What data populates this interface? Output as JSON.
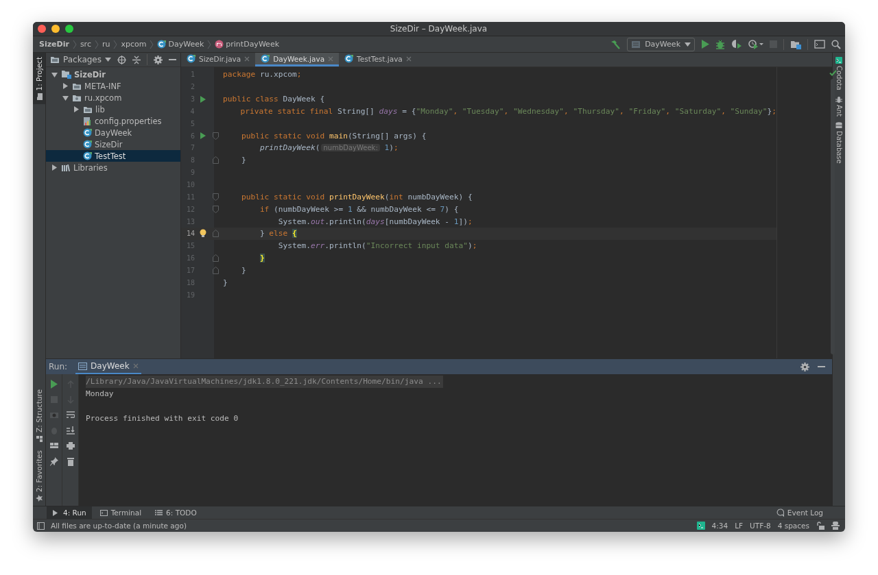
{
  "window": {
    "title": "SizeDir – DayWeek.java"
  },
  "breadcrumbs": [
    {
      "label": "SizeDir",
      "kind": "root"
    },
    {
      "label": "src",
      "kind": "folder"
    },
    {
      "label": "ru",
      "kind": "folder"
    },
    {
      "label": "xpcom",
      "kind": "folder"
    },
    {
      "label": "DayWeek",
      "kind": "class"
    },
    {
      "label": "printDayWeek",
      "kind": "method"
    }
  ],
  "toolbar": {
    "run_config": "DayWeek",
    "stop_disabled": true
  },
  "left_tool_tabs": [
    {
      "label": "1: Project",
      "selected": true,
      "kind": "project"
    },
    {
      "label": "Z: Structure",
      "selected": false,
      "kind": "structure"
    },
    {
      "label": "2: Favorites",
      "selected": false,
      "kind": "favorites"
    }
  ],
  "right_tool_tabs": [
    {
      "label": "Codota",
      "kind": "codota"
    },
    {
      "label": "Ant",
      "kind": "ant"
    },
    {
      "label": "Database",
      "kind": "database"
    }
  ],
  "project": {
    "view": "Packages",
    "tree": [
      {
        "label": "SizeDir",
        "kind": "module",
        "expanded": true,
        "selected": false,
        "children": [
          {
            "label": "META-INF",
            "kind": "folder",
            "expanded": false,
            "selected": false
          },
          {
            "label": "ru.xpcom",
            "kind": "package",
            "expanded": true,
            "selected": false,
            "children": [
              {
                "label": "lib",
                "kind": "folder",
                "expanded": false,
                "selected": false
              },
              {
                "label": "config.properties",
                "kind": "properties",
                "selected": false
              },
              {
                "label": "DayWeek",
                "kind": "class",
                "selected": false
              },
              {
                "label": "SizeDir",
                "kind": "class",
                "selected": false
              },
              {
                "label": "TestTest",
                "kind": "class",
                "selected": true
              }
            ]
          }
        ]
      },
      {
        "label": "Libraries",
        "kind": "library",
        "expanded": false,
        "selected": false
      }
    ]
  },
  "editor_tabs": [
    {
      "label": "SizeDir.java",
      "selected": false
    },
    {
      "label": "DayWeek.java",
      "selected": true
    },
    {
      "label": "TestTest.java",
      "selected": false
    }
  ],
  "code": [
    {
      "number": "1",
      "current": false,
      "tokens": [
        {
          "kind": "kw",
          "text": "package"
        },
        {
          "kind": "plain",
          "text": " ru.xpcom"
        },
        {
          "kind": "kw",
          "text": ";"
        }
      ]
    },
    {
      "number": "2",
      "current": false
    },
    {
      "number": "3",
      "current": false,
      "run": true,
      "tokens": [
        {
          "kind": "kw",
          "text": "public class"
        },
        {
          "kind": "plain",
          "text": " DayWeek {"
        }
      ]
    },
    {
      "number": "4",
      "current": false,
      "tokens": [
        {
          "kind": "kw",
          "text": "    private static final"
        },
        {
          "kind": "plain",
          "text": " String[] "
        },
        {
          "kind": "field",
          "text": "days"
        },
        {
          "kind": "plain",
          "text": " = {"
        },
        {
          "kind": "str",
          "text": "\"Monday\""
        },
        {
          "kind": "kw",
          "text": ", "
        },
        {
          "kind": "str",
          "text": "\"Tuesday\""
        },
        {
          "kind": "kw",
          "text": ", "
        },
        {
          "kind": "str",
          "text": "\"Wednesday\""
        },
        {
          "kind": "kw",
          "text": ", "
        },
        {
          "kind": "str",
          "text": "\"Thursday\""
        },
        {
          "kind": "kw",
          "text": ", "
        },
        {
          "kind": "str",
          "text": "\"Friday\""
        },
        {
          "kind": "kw",
          "text": ", "
        },
        {
          "kind": "str",
          "text": "\"Saturday\""
        },
        {
          "kind": "kw",
          "text": ", "
        },
        {
          "kind": "str",
          "text": "\"Sunday\""
        },
        {
          "kind": "plain",
          "text": "}"
        },
        {
          "kind": "kw",
          "text": ";"
        }
      ]
    },
    {
      "number": "5",
      "current": false
    },
    {
      "number": "6",
      "current": false,
      "run": true,
      "fold_open": true,
      "tokens": [
        {
          "kind": "kw",
          "text": "    public static void "
        },
        {
          "kind": "decl",
          "text": "main"
        },
        {
          "kind": "plain",
          "text": "(String[] args) {"
        }
      ]
    },
    {
      "number": "7",
      "current": false,
      "tokens": [
        {
          "kind": "call",
          "text": "        printDayWeek"
        },
        {
          "kind": "plain",
          "text": "("
        },
        {
          "kind": "hint",
          "text": "numbDayWeek:"
        },
        {
          "kind": "num",
          "text": " 1"
        },
        {
          "kind": "plain",
          "text": ")"
        },
        {
          "kind": "kw",
          "text": ";"
        }
      ]
    },
    {
      "number": "8",
      "current": false,
      "fold_close": true,
      "tokens": [
        {
          "kind": "plain",
          "text": "    }"
        }
      ]
    },
    {
      "number": "9",
      "current": false
    },
    {
      "number": "10",
      "current": false
    },
    {
      "number": "11",
      "current": false,
      "fold_open": true,
      "tokens": [
        {
          "kind": "kw",
          "text": "    public static void "
        },
        {
          "kind": "decl",
          "text": "printDayWeek"
        },
        {
          "kind": "plain",
          "text": "("
        },
        {
          "kind": "kw",
          "text": "int"
        },
        {
          "kind": "plain",
          "text": " numbDayWeek) {"
        }
      ]
    },
    {
      "number": "12",
      "current": false,
      "fold_open": true,
      "tokens": [
        {
          "kind": "kw",
          "text": "        if"
        },
        {
          "kind": "plain",
          "text": " (numbDayWeek >= "
        },
        {
          "kind": "num",
          "text": "1"
        },
        {
          "kind": "plain",
          "text": " && numbDayWeek <= "
        },
        {
          "kind": "num",
          "text": "7"
        },
        {
          "kind": "plain",
          "text": ") {"
        }
      ]
    },
    {
      "number": "13",
      "current": false,
      "tokens": [
        {
          "kind": "plain",
          "text": "            System."
        },
        {
          "kind": "field",
          "text": "out"
        },
        {
          "kind": "plain",
          "text": ".println("
        },
        {
          "kind": "field",
          "text": "days"
        },
        {
          "kind": "plain",
          "text": "[numbDayWeek - "
        },
        {
          "kind": "num",
          "text": "1"
        },
        {
          "kind": "plain",
          "text": "])"
        },
        {
          "kind": "kw",
          "text": ";"
        }
      ]
    },
    {
      "number": "14",
      "current": true,
      "fold_close": true,
      "bulb": true,
      "tokens": [
        {
          "kind": "plain",
          "text": "        } "
        },
        {
          "kind": "kw",
          "text": "else "
        },
        {
          "kind": "brace",
          "text": "{"
        }
      ]
    },
    {
      "number": "15",
      "current": false,
      "tokens": [
        {
          "kind": "plain",
          "text": "            System."
        },
        {
          "kind": "field",
          "text": "err"
        },
        {
          "kind": "plain",
          "text": ".println("
        },
        {
          "kind": "str",
          "text": "\"Incorrect input data\""
        },
        {
          "kind": "plain",
          "text": ")"
        },
        {
          "kind": "kw",
          "text": ";"
        }
      ]
    },
    {
      "number": "16",
      "current": false,
      "fold_close": true,
      "tokens": [
        {
          "kind": "brace",
          "text": "        }"
        }
      ]
    },
    {
      "number": "17",
      "current": false,
      "fold_close": true,
      "tokens": [
        {
          "kind": "plain",
          "text": "    }"
        }
      ]
    },
    {
      "number": "18",
      "current": false,
      "tokens": [
        {
          "kind": "plain",
          "text": "}"
        }
      ]
    },
    {
      "number": "19",
      "current": false
    }
  ],
  "run_panel": {
    "label": "Run:",
    "tabs": [
      {
        "label": "DayWeek",
        "selected": true
      }
    ],
    "console": [
      {
        "kind": "command",
        "text": "/Library/Java/JavaVirtualMachines/jdk1.8.0_221.jdk/Contents/Home/bin/java ..."
      },
      {
        "kind": "output",
        "text": "Monday"
      },
      {
        "kind": "exit",
        "text": "Process finished with exit code 0"
      }
    ]
  },
  "bottom_tool_tabs": [
    {
      "label": "4: Run",
      "kind": "run",
      "selected": true
    },
    {
      "label": "Terminal",
      "kind": "terminal",
      "selected": false
    },
    {
      "label": "6: TODO",
      "kind": "todo",
      "selected": false
    }
  ],
  "event_log": "Event Log",
  "status_bar": {
    "message": "All files are up-to-date (a minute ago)",
    "items": [
      "4:34",
      "LF",
      "UTF-8",
      "4 spaces"
    ]
  }
}
